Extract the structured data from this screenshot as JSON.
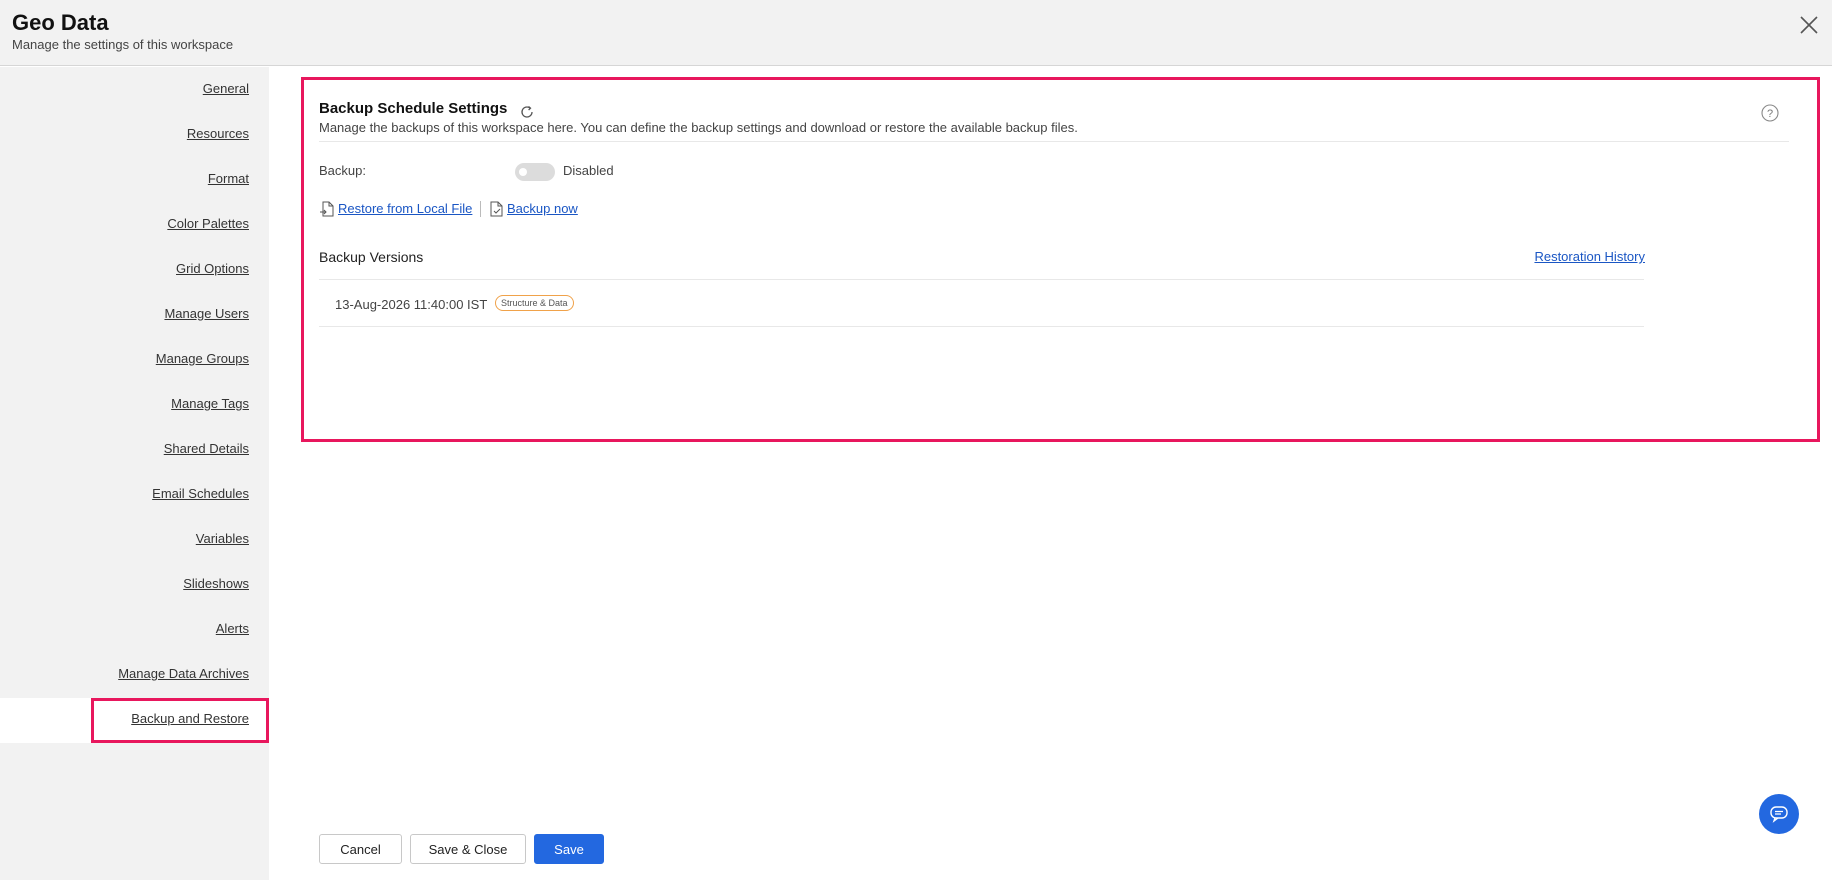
{
  "header": {
    "title": "Geo Data",
    "subtitle": "Manage the settings of this workspace",
    "close_icon": "close-icon"
  },
  "sidebar": {
    "items": [
      {
        "label": "General"
      },
      {
        "label": "Resources"
      },
      {
        "label": "Format"
      },
      {
        "label": "Color Palettes"
      },
      {
        "label": "Grid Options"
      },
      {
        "label": "Manage Users"
      },
      {
        "label": "Manage Groups"
      },
      {
        "label": "Manage Tags"
      },
      {
        "label": "Shared Details"
      },
      {
        "label": "Email Schedules"
      },
      {
        "label": "Variables"
      },
      {
        "label": "Slideshows"
      },
      {
        "label": "Alerts"
      },
      {
        "label": "Manage Data Archives"
      },
      {
        "label": "Backup and Restore"
      }
    ],
    "active_item": "Backup and Restore"
  },
  "main": {
    "section_title": "Backup Schedule Settings",
    "section_description": "Manage the backups of this workspace here. You can define the backup settings and download or restore the available backup files.",
    "backup_label": "Backup:",
    "backup_toggle_state": "Disabled",
    "restore_link": "Restore from Local File",
    "backup_now_link": "Backup now",
    "versions_title": "Backup Versions",
    "restoration_history_link": "Restoration History",
    "versions": [
      {
        "date": "13-Aug-2026 11:40:00 IST",
        "badge": "Structure & Data"
      }
    ]
  },
  "footer": {
    "cancel_label": "Cancel",
    "save_close_label": "Save & Close",
    "save_label": "Save"
  },
  "colors": {
    "accent": "#2368e0",
    "highlight_border": "#e8175d",
    "link": "#1a56c4",
    "badge_border": "#f0a24a"
  }
}
